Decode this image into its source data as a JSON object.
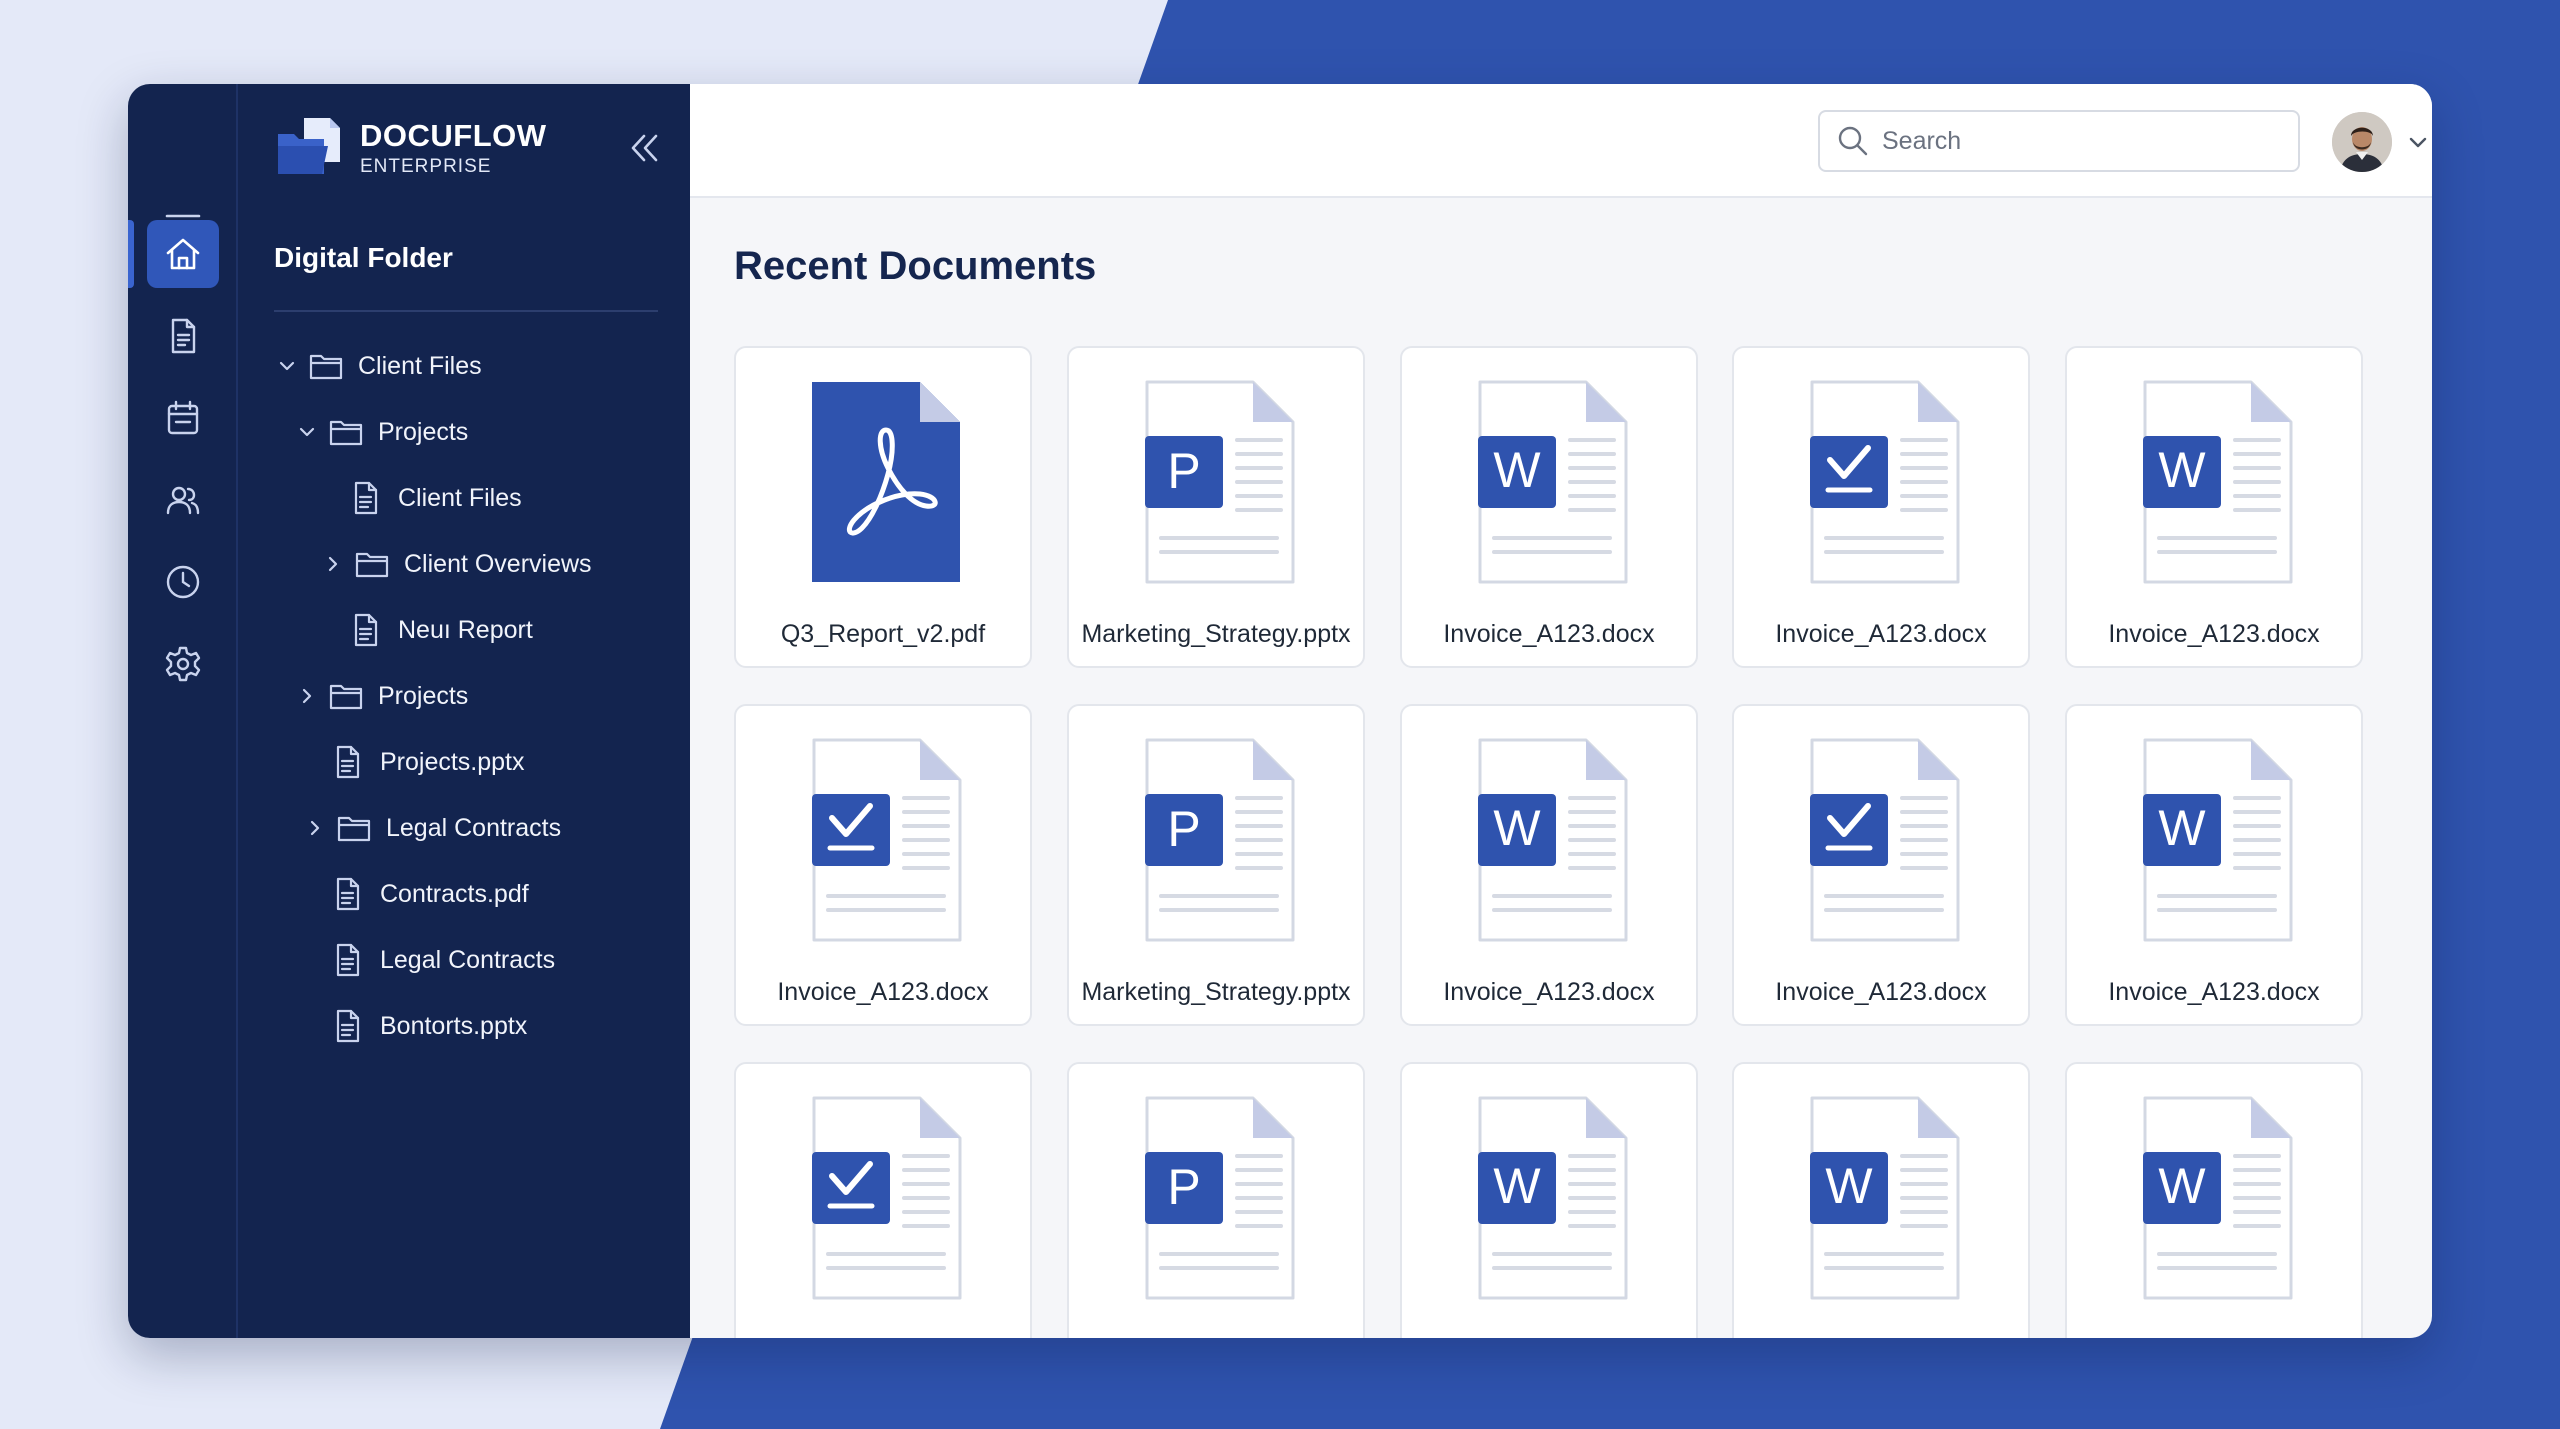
{
  "colors": {
    "background": "#e4e9f8",
    "accent_blue": "#2f53ae",
    "sidebar_bg": "#13244f",
    "active_item": "#3057b9",
    "main_bg": "#f5f6f9"
  },
  "app": {
    "brand_name": "DOCUFLOW",
    "brand_subtitle": "ENTERPRISE",
    "brand_icon": "folder-icon"
  },
  "rail": {
    "items": [
      {
        "icon": "menu-icon",
        "active": false
      },
      {
        "icon": "home-icon",
        "active": true
      },
      {
        "icon": "document-icon",
        "active": false
      },
      {
        "icon": "calendar-icon",
        "active": false
      },
      {
        "icon": "users-icon",
        "active": false
      },
      {
        "icon": "clock-icon",
        "active": false
      },
      {
        "icon": "settings-icon",
        "active": false
      }
    ]
  },
  "tree": {
    "title": "Digital Folder",
    "items": [
      {
        "label": "Client Files",
        "type": "folder",
        "chevron": "down"
      },
      {
        "label": "Projects",
        "type": "folder",
        "chevron": "down"
      },
      {
        "label": "Client Files",
        "type": "file",
        "chevron": ""
      },
      {
        "label": "Client Overviews",
        "type": "folder",
        "chevron": "right"
      },
      {
        "label": "Neuı Report",
        "type": "file",
        "chevron": ""
      },
      {
        "label": "Projects",
        "type": "folder",
        "chevron": "right"
      },
      {
        "label": "Projects.pptx",
        "type": "file",
        "chevron": ""
      },
      {
        "label": "Legal Contracts",
        "type": "folder",
        "chevron": "right"
      },
      {
        "label": "Contracts.pdf",
        "type": "file",
        "chevron": ""
      },
      {
        "label": "Legal Contracts",
        "type": "file",
        "chevron": ""
      },
      {
        "label": "Bontorts.pptx",
        "type": "file",
        "chevron": ""
      }
    ]
  },
  "header": {
    "search_placeholder": "Search",
    "search_icon": "search-icon",
    "avatar_icon": "avatar",
    "menu_icon": "chevron-down-icon"
  },
  "main": {
    "section_title": "Recent Documents",
    "documents": [
      {
        "name": "Q3_Report_v2.pdf",
        "kind": "pdf"
      },
      {
        "name": "Marketing_Strategy.pptx",
        "kind": "P"
      },
      {
        "name": "Invoice_A123.docx",
        "kind": "W"
      },
      {
        "name": "Invoice_A123.docx",
        "kind": "check"
      },
      {
        "name": "Invoice_A123.docx",
        "kind": "W"
      },
      {
        "name": "Invoice_A123.docx",
        "kind": "check"
      },
      {
        "name": "Marketing_Strategy.pptx",
        "kind": "P"
      },
      {
        "name": "Invoice_A123.docx",
        "kind": "W"
      },
      {
        "name": "Invoice_A123.docx",
        "kind": "check"
      },
      {
        "name": "Invoice_A123.docx",
        "kind": "W"
      },
      {
        "name": "",
        "kind": "check"
      },
      {
        "name": "",
        "kind": "P"
      },
      {
        "name": "",
        "kind": "W"
      },
      {
        "name": "",
        "kind": "W"
      },
      {
        "name": "",
        "kind": "W"
      }
    ]
  }
}
